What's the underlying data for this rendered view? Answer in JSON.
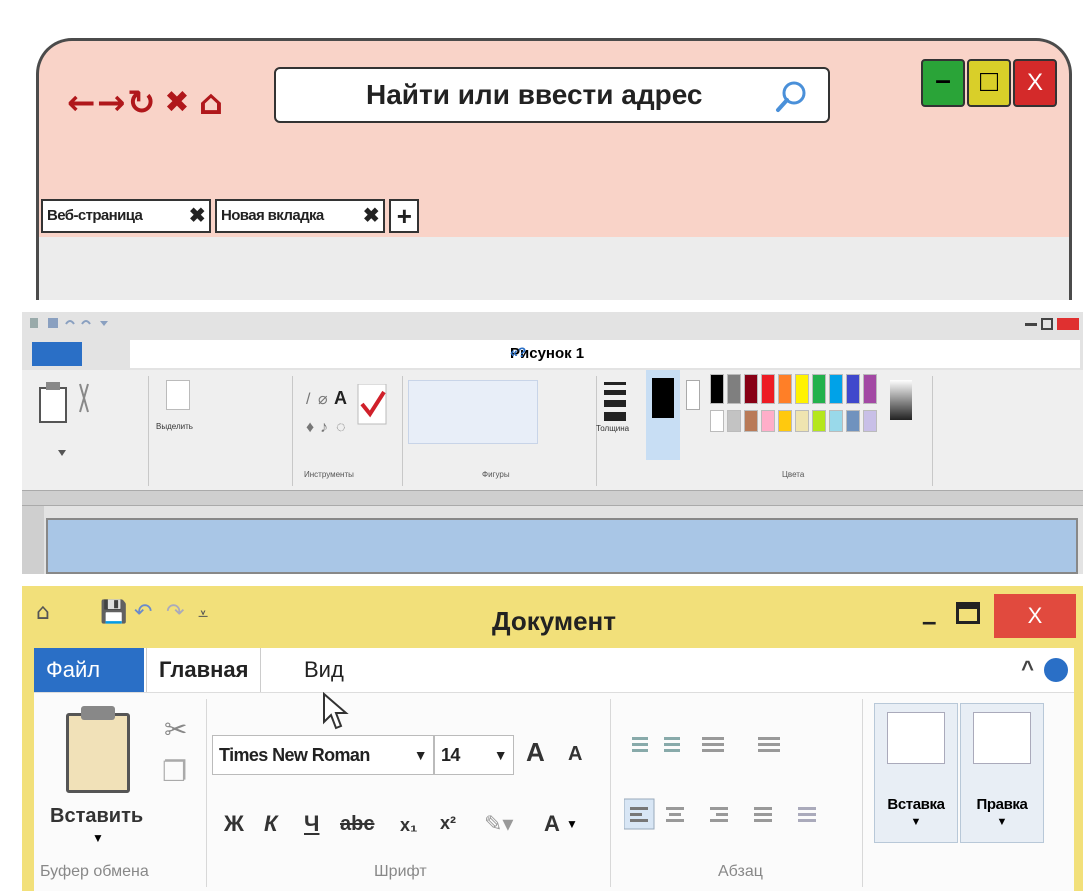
{
  "browser": {
    "nav_icons": [
      "back-icon",
      "forward-icon",
      "refresh-icon",
      "stop-icon",
      "home-icon"
    ],
    "address_placeholder": "Найти или ввести адрес",
    "window_buttons": {
      "minimize": "–",
      "maximize": "□",
      "close": "X"
    },
    "tabs": [
      {
        "label": "Веб-страница",
        "close": "✖"
      },
      {
        "label": "Новая вкладка",
        "close": "✖"
      }
    ],
    "new_tab": "+",
    "colors": {
      "frame": "#f9d3c8",
      "icons": "#b0171b",
      "minimize": "#2aa438",
      "maximize": "#d9cf29",
      "close": "#d42a2a"
    }
  },
  "paint": {
    "title": "Рисунок 1",
    "groups": [
      "Выделить",
      "Инструменты",
      "Фигуры",
      "Толщина",
      "Цвета"
    ],
    "palette_top": [
      "#000000",
      "#7f7f7f",
      "#880015",
      "#ed1c24",
      "#ff7f27",
      "#fff200",
      "#22b14c",
      "#00a2e8",
      "#3f48cc",
      "#a349a4"
    ],
    "palette_bottom": [
      "#ffffff",
      "#c3c3c3",
      "#b97a57",
      "#ffaec9",
      "#ffc90e",
      "#efe4b0",
      "#b5e61d",
      "#99d9ea",
      "#7092be",
      "#c8bfe7"
    ],
    "canvas_color": "#a9c6e6"
  },
  "word": {
    "title": "Документ",
    "window_buttons": {
      "minimize": "–",
      "close": "X"
    },
    "tabs": {
      "file": "Файл",
      "home": "Главная",
      "view": "Вид"
    },
    "clipboard": {
      "paste": "Вставить",
      "group": "Буфер обмена"
    },
    "font": {
      "name": "Times New Roman",
      "size": "14",
      "group": "Шрифт",
      "bold": "Ж",
      "italic": "К",
      "underline": "Ч",
      "strike": "abc",
      "sub": "x₁",
      "sup": "x²",
      "grow": "A",
      "shrink": "A",
      "color": "A"
    },
    "paragraph": {
      "group": "Абзац"
    },
    "insert": {
      "label": "Вставка"
    },
    "edit": {
      "label": "Правка"
    },
    "colors": {
      "titlebar": "#f2e07a",
      "file_tab": "#2a6fc6",
      "close": "#e14a3e"
    }
  }
}
